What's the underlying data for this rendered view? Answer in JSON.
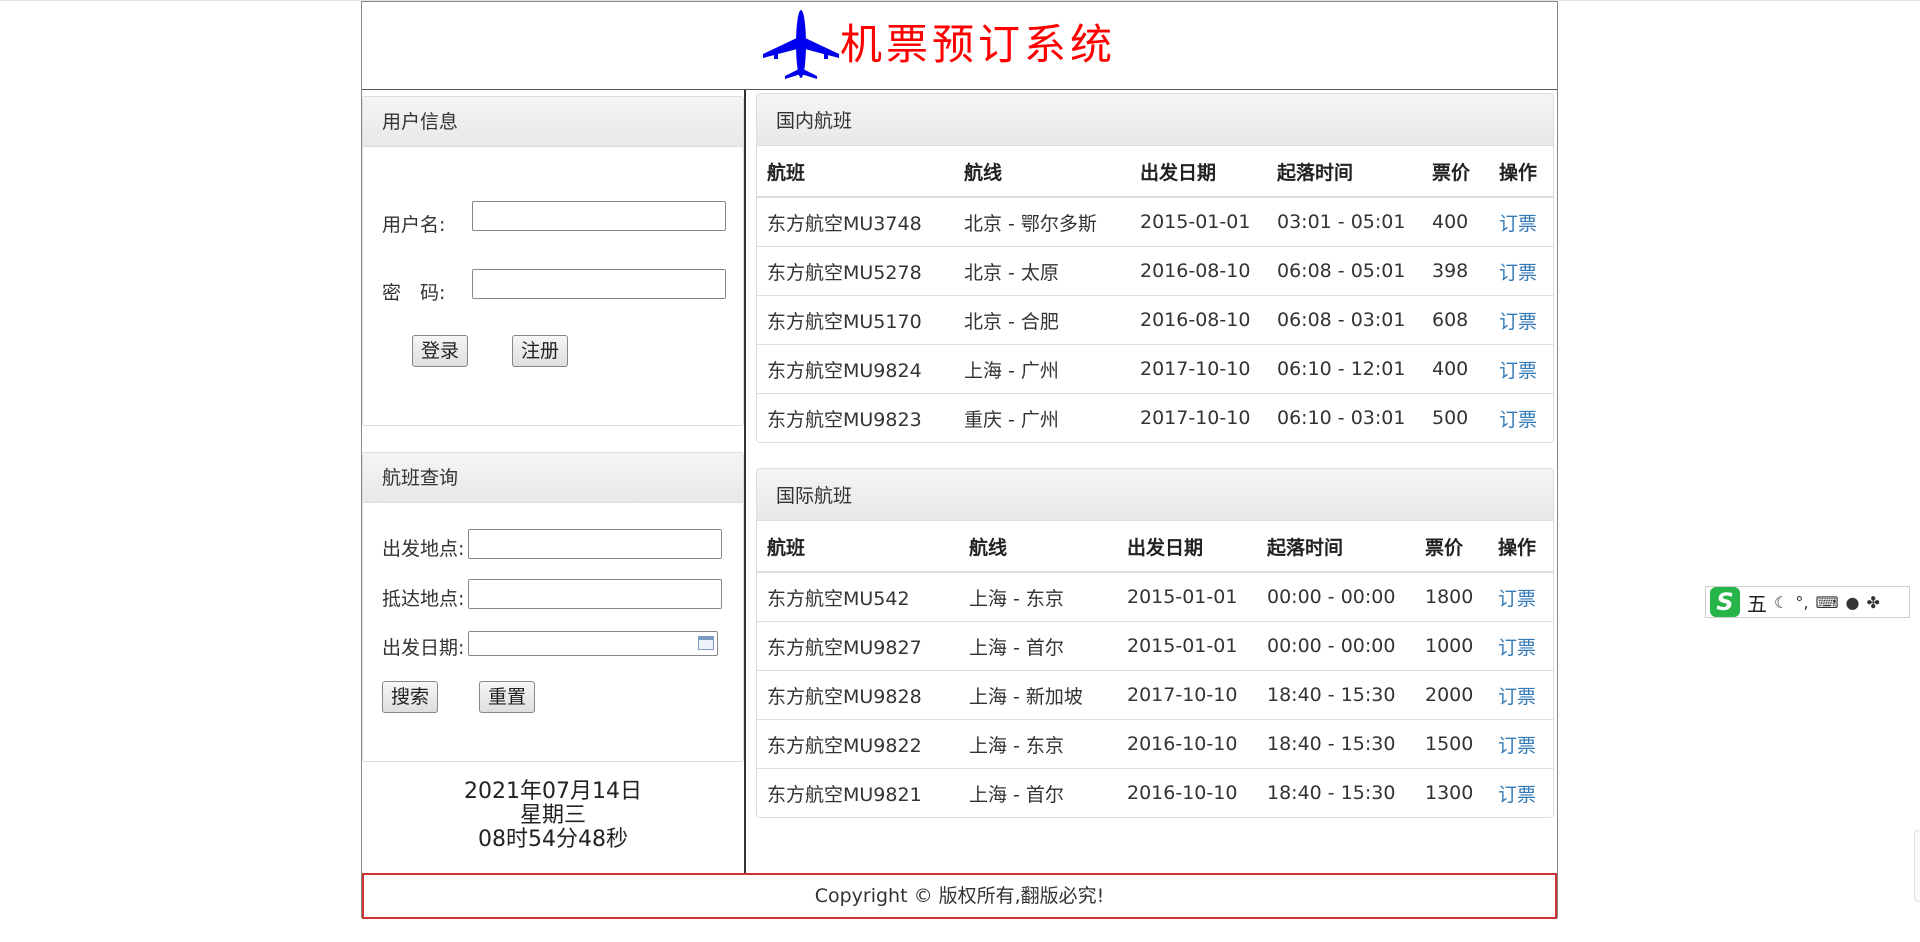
{
  "header": {
    "title": "机票预订系统"
  },
  "user_panel": {
    "title": "用户信息",
    "username_label": "用户名:",
    "password_label": "密　码:",
    "username_value": "",
    "password_value": "",
    "login_label": "登录",
    "register_label": "注册"
  },
  "search_panel": {
    "title": "航班查询",
    "from_label": "出发地点:",
    "to_label": "抵达地点:",
    "date_label": "出发日期:",
    "from_value": "",
    "to_value": "",
    "date_value": "",
    "search_label": "搜索",
    "reset_label": "重置"
  },
  "clock": {
    "date": "2021年07月14日",
    "weekday": "星期三",
    "time": "08时54分48秒"
  },
  "domestic": {
    "title": "国内航班",
    "columns": [
      "航班",
      "航线",
      "出发日期",
      "起落时间",
      "票价",
      "操作"
    ],
    "rows": [
      {
        "flight": "东方航空MU3748",
        "route": "北京 - 鄂尔多斯",
        "date": "2015-01-01",
        "time": "03:01 - 05:01",
        "price": "400",
        "action": "订票"
      },
      {
        "flight": "东方航空MU5278",
        "route": "北京 - 太原",
        "date": "2016-08-10",
        "time": "06:08 - 05:01",
        "price": "398",
        "action": "订票"
      },
      {
        "flight": "东方航空MU5170",
        "route": "北京 - 合肥",
        "date": "2016-08-10",
        "time": "06:08 - 03:01",
        "price": "608",
        "action": "订票"
      },
      {
        "flight": "东方航空MU9824",
        "route": "上海 - 广州",
        "date": "2017-10-10",
        "time": "06:10 - 12:01",
        "price": "400",
        "action": "订票"
      },
      {
        "flight": "东方航空MU9823",
        "route": "重庆 - 广州",
        "date": "2017-10-10",
        "time": "06:10 - 03:01",
        "price": "500",
        "action": "订票"
      }
    ]
  },
  "international": {
    "title": "国际航班",
    "columns": [
      "航班",
      "航线",
      "出发日期",
      "起落时间",
      "票价",
      "操作"
    ],
    "rows": [
      {
        "flight": "东方航空MU542",
        "route": "上海 - 东京",
        "date": "2015-01-01",
        "time": "00:00 - 00:00",
        "price": "1800",
        "action": "订票"
      },
      {
        "flight": "东方航空MU9827",
        "route": "上海 - 首尔",
        "date": "2015-01-01",
        "time": "00:00 - 00:00",
        "price": "1000",
        "action": "订票"
      },
      {
        "flight": "东方航空MU9828",
        "route": "上海 - 新加坡",
        "date": "2017-10-10",
        "time": "18:40 - 15:30",
        "price": "2000",
        "action": "订票"
      },
      {
        "flight": "东方航空MU9822",
        "route": "上海 - 东京",
        "date": "2016-10-10",
        "time": "18:40 - 15:30",
        "price": "1500",
        "action": "订票"
      },
      {
        "flight": "东方航空MU9821",
        "route": "上海 - 首尔",
        "date": "2016-10-10",
        "time": "18:40 - 15:30",
        "price": "1300",
        "action": "订票"
      }
    ]
  },
  "footer": {
    "text": "Copyright © 版权所有,翻版必究!"
  },
  "ime_toolbar": {
    "logo": "S",
    "mode": "五",
    "icons": [
      "moon-icon",
      "punctuation-icon",
      "keyboard-icon",
      "user-icon",
      "apps-icon"
    ]
  },
  "colors": {
    "title_red": "#ff0000",
    "plane_blue": "#0000ee",
    "link_blue": "#337ab7",
    "footer_border": "#cc3333"
  }
}
